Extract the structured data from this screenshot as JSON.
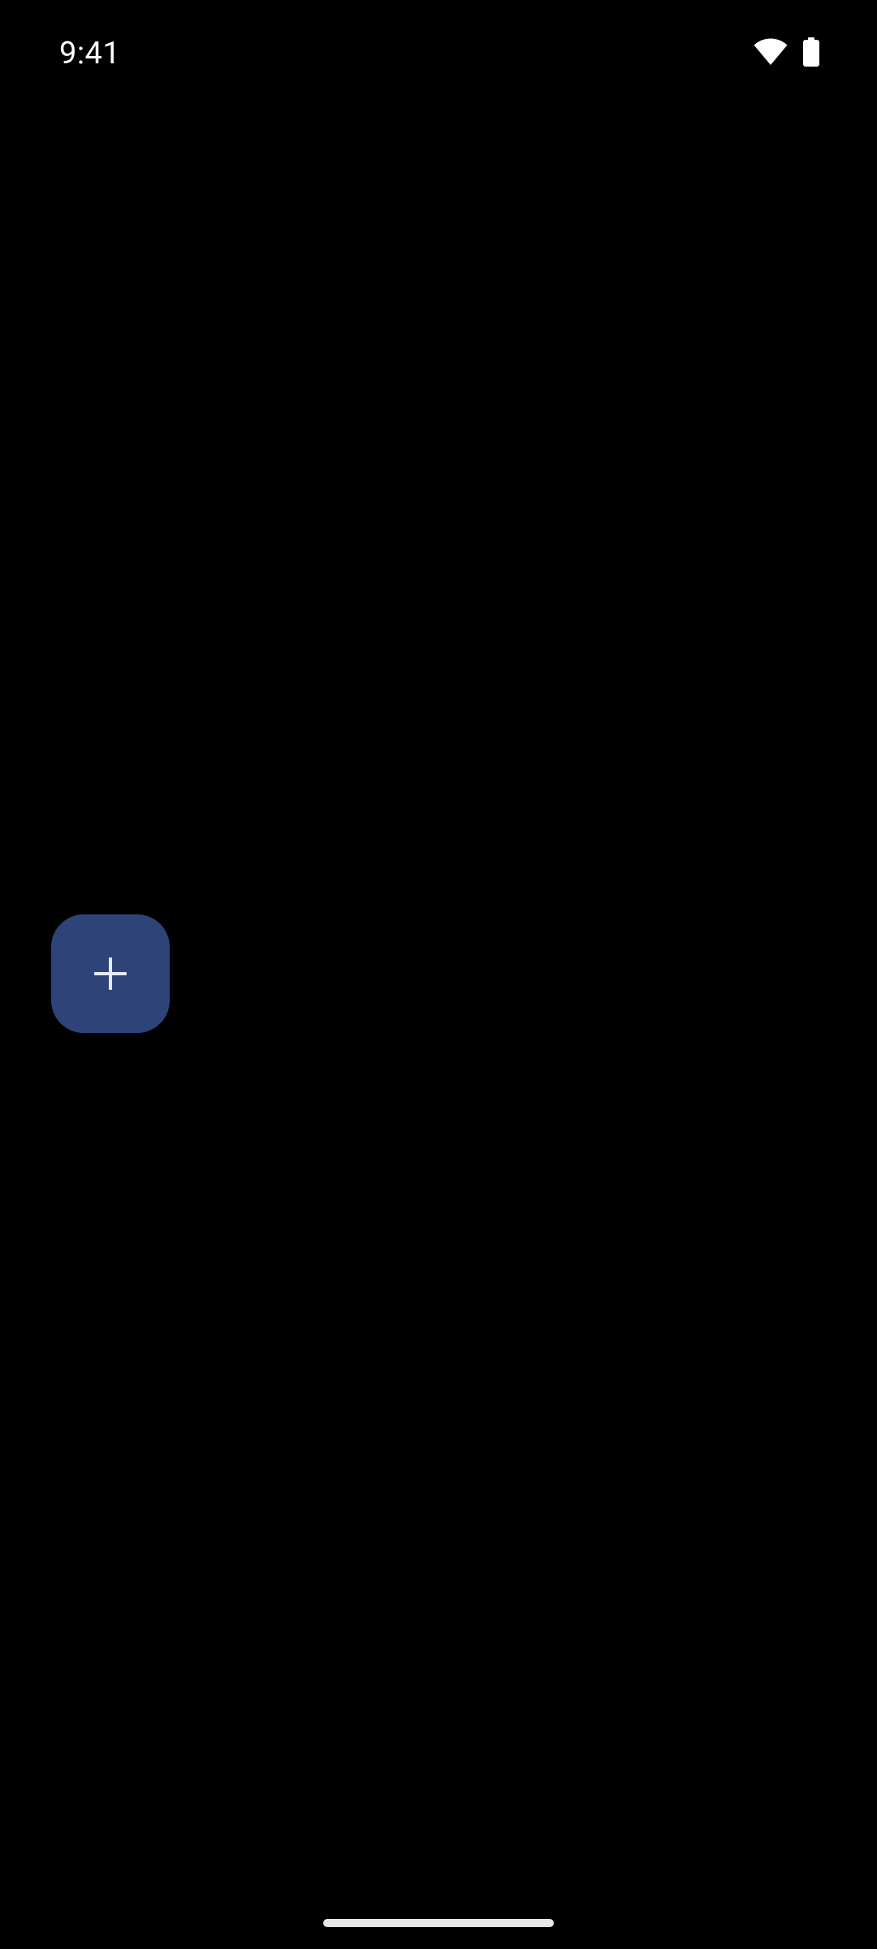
{
  "status_bar": {
    "time": "9:41",
    "icons": [
      "wifi-icon",
      "battery-icon"
    ]
  },
  "fab": {
    "icon": "plus-icon",
    "background_color": "#2e4479",
    "icon_color": "#e6ebff"
  },
  "navigation": {
    "type": "gesture-handle"
  },
  "theme": {
    "background": "#000000",
    "text_color": "#ffffff"
  }
}
